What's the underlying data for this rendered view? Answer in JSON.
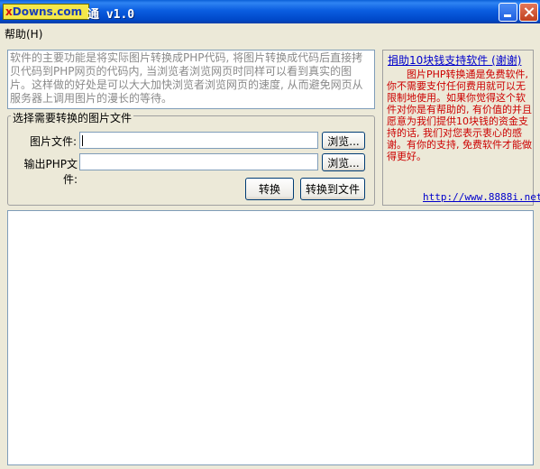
{
  "window": {
    "logo_x": "x",
    "logo_rest": "Downs",
    "logo_com": ".com",
    "title": "通 v1.0",
    "minimize_icon": "minimize-icon",
    "close_icon": "close-icon"
  },
  "menu": {
    "help": "帮助(H)"
  },
  "description": "软件的主要功能是将实际图片转换成PHP代码, 将图片转换成代码后直接拷贝代码到PHP网页的代码内, 当浏览者浏览网页时同样可以看到真实的图片。这样做的好处是可以大大加快浏览者浏览网页的速度, 从而避免网页从服务器上调用图片的漫长的等待。",
  "group": {
    "legend": "选择需要转换的图片文件",
    "image_label": "图片文件:",
    "image_value": "",
    "output_label": "输出PHP文件:",
    "output_value": "",
    "browse1": "浏览...",
    "browse2": "浏览...",
    "convert": "转换",
    "convert_to_file": "转换到文件"
  },
  "donate": {
    "title": "捐助10块钱支持软件 (谢谢)",
    "body": "图片PHP转换通是免费软件, 你不需要支付任何费用就可以无限制地使用。如果你觉得这个软件对你是有帮助的, 有价值的并且愿意为我们提供10块钱的资金支持的话, 我们对您表示衷心的感谢。有你的支持, 免费软件才能做得更好。",
    "link": "http://www.8888i.net"
  },
  "output": {
    "content": ""
  }
}
